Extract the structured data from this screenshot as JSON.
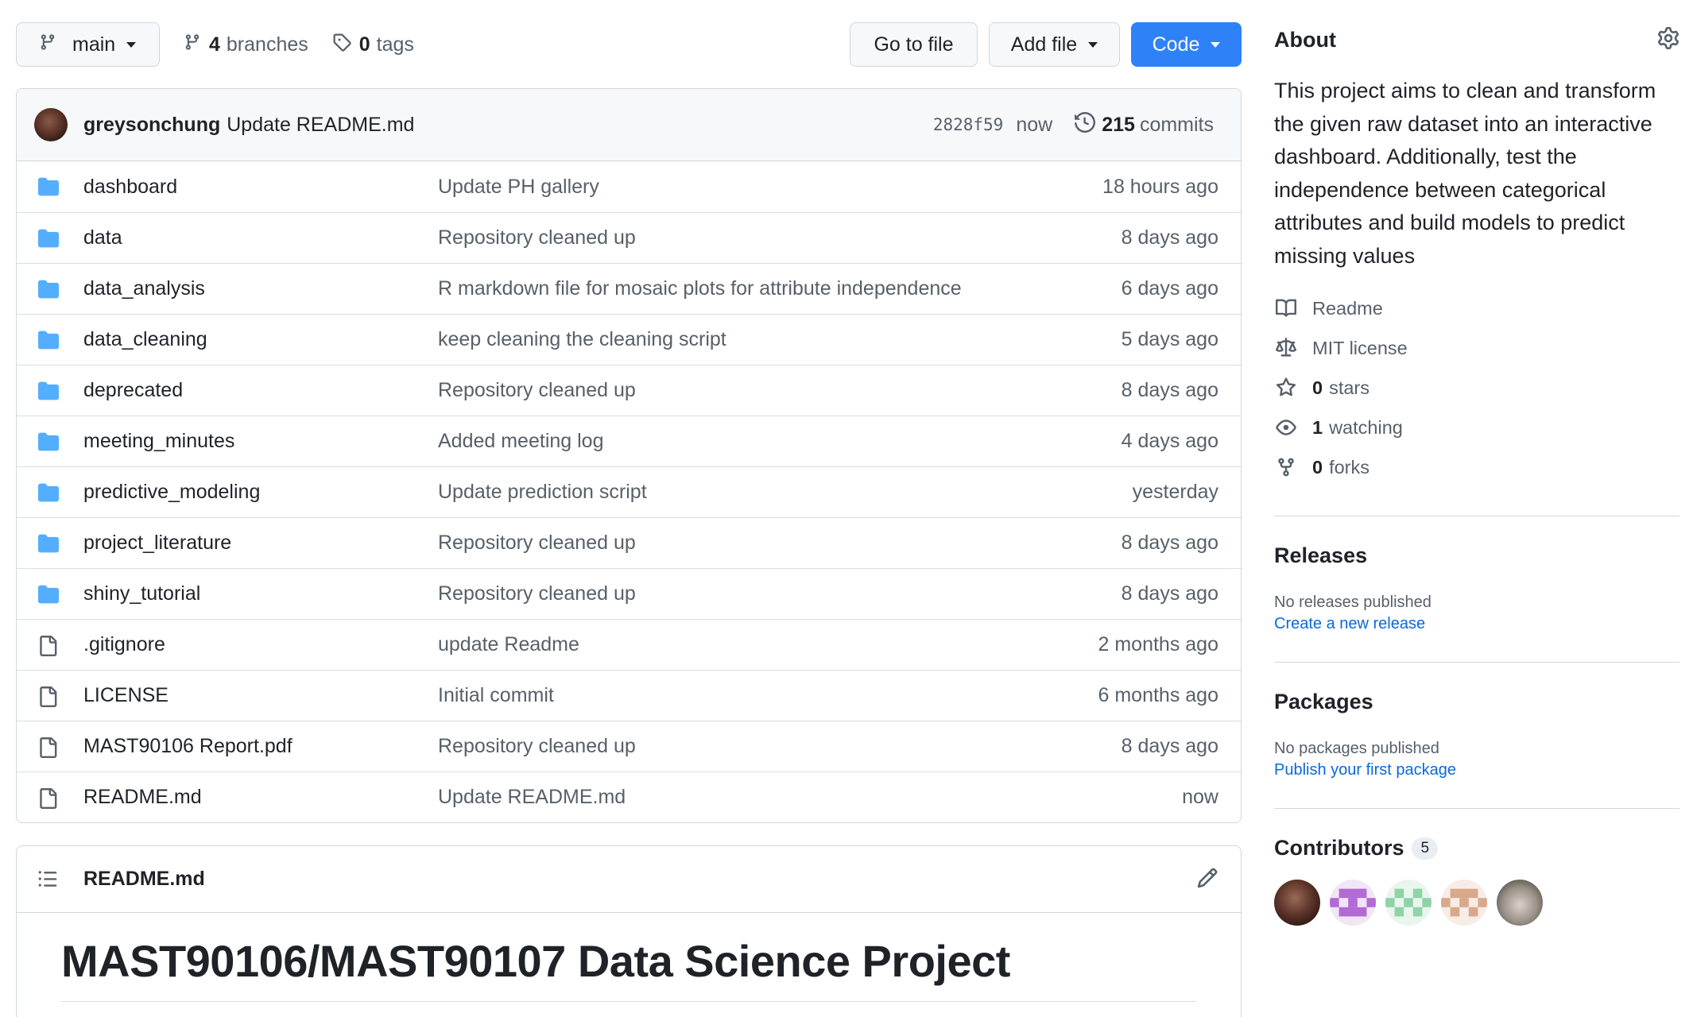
{
  "toolbar": {
    "branch": "main",
    "branches_count": "4",
    "branches_label": "branches",
    "tags_count": "0",
    "tags_label": "tags",
    "go_to_file": "Go to file",
    "add_file": "Add file",
    "code": "Code"
  },
  "commit": {
    "author": "greysonchung",
    "message": "Update README.md",
    "sha": "2828f59",
    "time": "now",
    "commits_count": "215",
    "commits_label": "commits"
  },
  "files": [
    {
      "type": "folder",
      "name": "dashboard",
      "message": "Update PH gallery",
      "age": "18 hours ago"
    },
    {
      "type": "folder",
      "name": "data",
      "message": "Repository cleaned up",
      "age": "8 days ago"
    },
    {
      "type": "folder",
      "name": "data_analysis",
      "message": "R markdown file for mosaic plots for attribute independence",
      "age": "6 days ago"
    },
    {
      "type": "folder",
      "name": "data_cleaning",
      "message": "keep cleaning the cleaning script",
      "age": "5 days ago"
    },
    {
      "type": "folder",
      "name": "deprecated",
      "message": "Repository cleaned up",
      "age": "8 days ago"
    },
    {
      "type": "folder",
      "name": "meeting_minutes",
      "message": "Added meeting log",
      "age": "4 days ago"
    },
    {
      "type": "folder",
      "name": "predictive_modeling",
      "message": "Update prediction script",
      "age": "yesterday"
    },
    {
      "type": "folder",
      "name": "project_literature",
      "message": "Repository cleaned up",
      "age": "8 days ago"
    },
    {
      "type": "folder",
      "name": "shiny_tutorial",
      "message": "Repository cleaned up",
      "age": "8 days ago"
    },
    {
      "type": "file",
      "name": ".gitignore",
      "message": "update Readme",
      "age": "2 months ago"
    },
    {
      "type": "file",
      "name": "LICENSE",
      "message": "Initial commit",
      "age": "6 months ago"
    },
    {
      "type": "file",
      "name": "MAST90106 Report.pdf",
      "message": "Repository cleaned up",
      "age": "8 days ago"
    },
    {
      "type": "file",
      "name": "README.md",
      "message": "Update README.md",
      "age": "now"
    }
  ],
  "readme": {
    "filename": "README.md",
    "title": "MAST90106/MAST90107 Data Science Project"
  },
  "about": {
    "heading": "About",
    "description": "This project aims to clean and transform the given raw dataset into an interactive dashboard. Additionally, test the independence between categorical attributes and build models to predict missing values",
    "readme": "Readme",
    "license": "MIT license",
    "stars_count": "0",
    "stars_label": "stars",
    "watching_count": "1",
    "watching_label": "watching",
    "forks_count": "0",
    "forks_label": "forks"
  },
  "releases": {
    "heading": "Releases",
    "none": "No releases published",
    "link": "Create a new release"
  },
  "packages": {
    "heading": "Packages",
    "none": "No packages published",
    "link": "Publish your first package"
  },
  "contributors": {
    "heading": "Contributors",
    "count": "5"
  },
  "colors": {
    "accent": "#2f81f7",
    "folder": "#54aeff",
    "link": "#0969da"
  }
}
